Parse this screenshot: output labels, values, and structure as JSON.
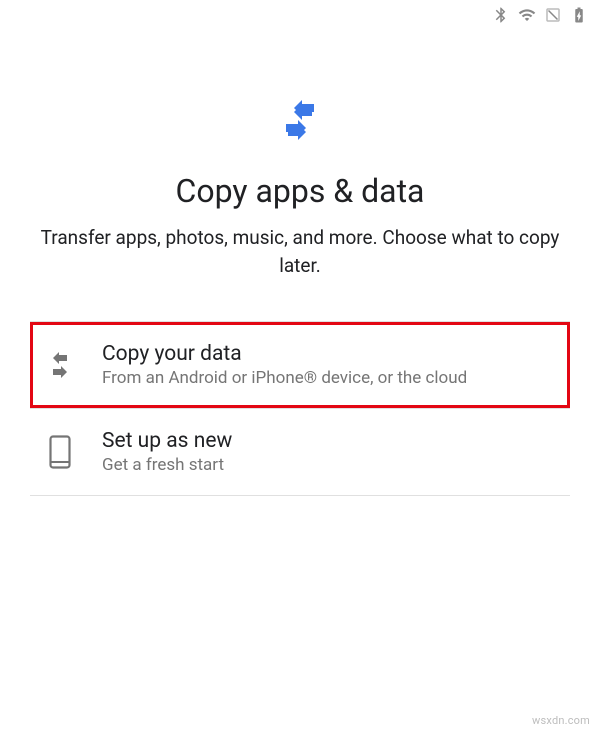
{
  "status_bar": {
    "icons": [
      "bluetooth",
      "wifi",
      "no-sim",
      "battery-charging"
    ]
  },
  "hero": {
    "title": "Copy apps & data",
    "subtitle": "Transfer apps, photos, music, and more. Choose what to copy later.",
    "icon_color": "#3b78e7"
  },
  "options": [
    {
      "id": "copy-your-data",
      "title": "Copy your data",
      "subtitle": "From an Android or iPhone® device, or the cloud",
      "highlighted": true,
      "icon": "transfer"
    },
    {
      "id": "set-up-as-new",
      "title": "Set up as new",
      "subtitle": "Get a fresh start",
      "highlighted": false,
      "icon": "phone"
    }
  ],
  "watermark": "wsxdn.com",
  "colors": {
    "highlight_border": "#e30613",
    "text_primary": "#202124",
    "text_secondary": "#757575",
    "divider": "#e0e0e0"
  }
}
